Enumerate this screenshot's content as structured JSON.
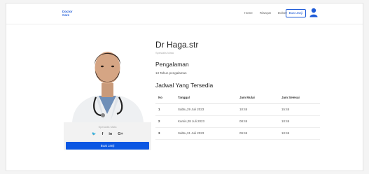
{
  "navbar": {
    "logo_line1": "Doctor",
    "logo_line2": "Care",
    "links": [
      "Home",
      "Riwayat",
      "Dokter"
    ],
    "cta_label": "Buat Janji"
  },
  "profile": {
    "specialist_label": "Spesialis Mata",
    "social_icons": [
      "twitter-icon",
      "facebook-icon",
      "linkedin-icon",
      "google-plus-icon"
    ],
    "social_glyphs": [
      "🐦",
      "f",
      "in",
      "G+"
    ],
    "book_button": "Buat Janji"
  },
  "doctor": {
    "name": "Dr Haga.str",
    "subtitle": "Spesialis Mata",
    "experience_title": "Pengalaman",
    "experience_text": "13 Tahun pengalaman",
    "schedule_title": "Jadwal Yang Tersedia"
  },
  "schedule": {
    "headers": [
      "No",
      "Tanggal",
      "Jam Mulai",
      "Jam Selesai"
    ],
    "rows": [
      [
        "1",
        "Sabtu,29 Juli 2023",
        "10:45",
        "15:45"
      ],
      [
        "2",
        "Kamis,28 Juli 2023",
        "08:45",
        "10:45"
      ],
      [
        "3",
        "Sabtu,31 Juli 2023",
        "09:45",
        "10:45"
      ]
    ]
  },
  "colors": {
    "accent": "#0b57e3"
  }
}
